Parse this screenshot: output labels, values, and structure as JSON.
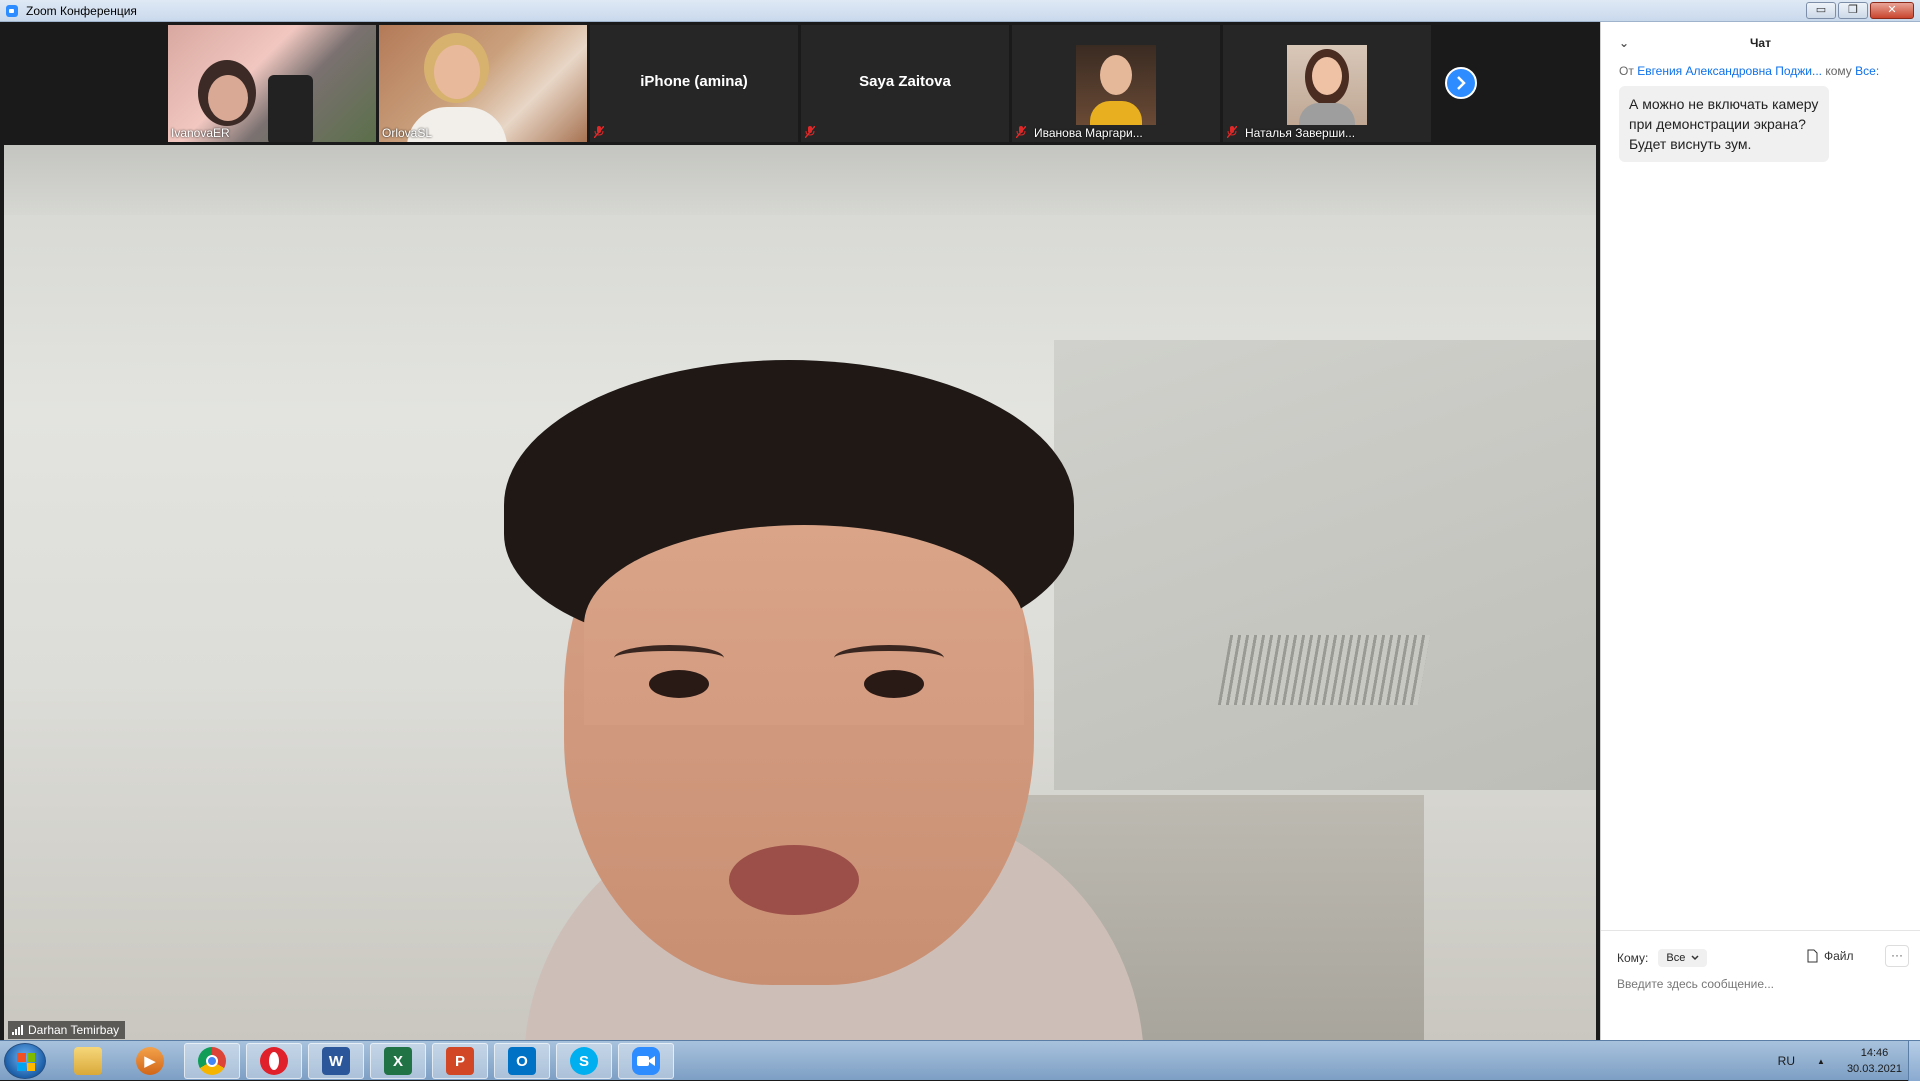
{
  "window": {
    "title": "Zoom Конференция",
    "controls": {
      "minimize": "▭",
      "restore": "❐",
      "close": "✕"
    }
  },
  "participants": [
    {
      "name": "IvanovaER",
      "video": true,
      "muted": false
    },
    {
      "name": "OrlovaSL",
      "video": true,
      "muted": false
    },
    {
      "name": "iPhone (amina)",
      "video": false,
      "muted": true
    },
    {
      "name": "Saya Zaitova",
      "video": false,
      "muted": true
    },
    {
      "name": "Иванова Маргари...",
      "video": false,
      "muted": true,
      "avatar": true
    },
    {
      "name": "Наталья Заверши...",
      "video": false,
      "muted": true,
      "avatar": true
    }
  ],
  "strip": {
    "next_icon": "chevron-right-icon"
  },
  "main_video": {
    "speaker": "Darhan  Temirbay"
  },
  "chat": {
    "title": "Чат",
    "message": {
      "from_prefix": "От",
      "sender": "Евгения Александровна Поджи...",
      "to_prefix": "кому",
      "recipient": "Все:",
      "text": "А можно не включать камеру при демонстрации экрана? Будет виснуть зум."
    },
    "footer": {
      "to_label": "Кому:",
      "to_value": "Все",
      "file_label": "Файл",
      "more_label": "···",
      "input_placeholder": "Введите здесь сообщение..."
    }
  },
  "taskbar": {
    "apps": [
      "file-explorer",
      "media-player",
      "chrome",
      "opera",
      "word",
      "excel",
      "powerpoint",
      "outlook",
      "skype",
      "zoom"
    ],
    "app_letters": {
      "word": "W",
      "excel": "X",
      "powerpoint": "P",
      "outlook": "O",
      "skype": "S",
      "opera": "O"
    },
    "language": "RU",
    "tray_arrow": "▲",
    "time": "14:46",
    "date": "30.03.2021"
  },
  "colors": {
    "zoom_blue": "#2d8cff",
    "chat_link": "#0e71eb"
  }
}
